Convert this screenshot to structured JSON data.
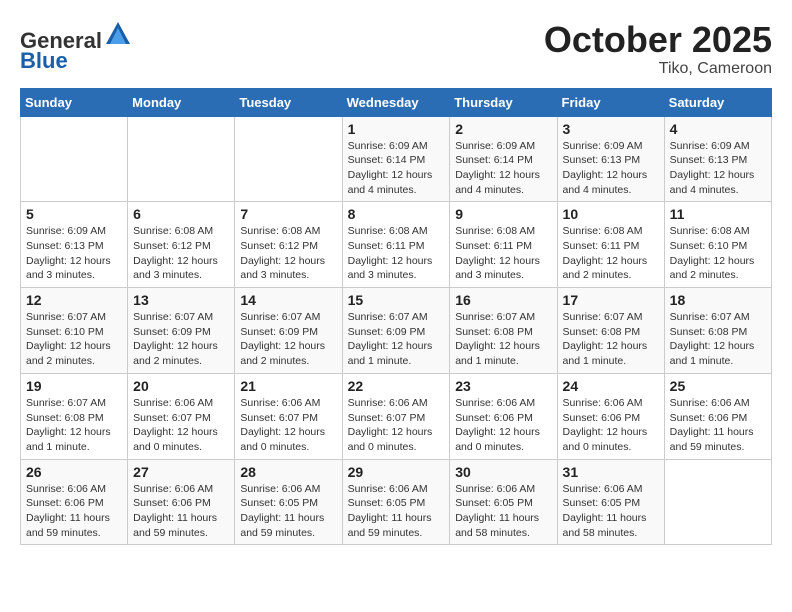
{
  "header": {
    "logo_line1": "General",
    "logo_line2": "Blue",
    "month": "October 2025",
    "location": "Tiko, Cameroon"
  },
  "weekdays": [
    "Sunday",
    "Monday",
    "Tuesday",
    "Wednesday",
    "Thursday",
    "Friday",
    "Saturday"
  ],
  "weeks": [
    [
      {
        "day": "",
        "info": ""
      },
      {
        "day": "",
        "info": ""
      },
      {
        "day": "",
        "info": ""
      },
      {
        "day": "1",
        "info": "Sunrise: 6:09 AM\nSunset: 6:14 PM\nDaylight: 12 hours and 4 minutes."
      },
      {
        "day": "2",
        "info": "Sunrise: 6:09 AM\nSunset: 6:14 PM\nDaylight: 12 hours and 4 minutes."
      },
      {
        "day": "3",
        "info": "Sunrise: 6:09 AM\nSunset: 6:13 PM\nDaylight: 12 hours and 4 minutes."
      },
      {
        "day": "4",
        "info": "Sunrise: 6:09 AM\nSunset: 6:13 PM\nDaylight: 12 hours and 4 minutes."
      }
    ],
    [
      {
        "day": "5",
        "info": "Sunrise: 6:09 AM\nSunset: 6:13 PM\nDaylight: 12 hours and 3 minutes."
      },
      {
        "day": "6",
        "info": "Sunrise: 6:08 AM\nSunset: 6:12 PM\nDaylight: 12 hours and 3 minutes."
      },
      {
        "day": "7",
        "info": "Sunrise: 6:08 AM\nSunset: 6:12 PM\nDaylight: 12 hours and 3 minutes."
      },
      {
        "day": "8",
        "info": "Sunrise: 6:08 AM\nSunset: 6:11 PM\nDaylight: 12 hours and 3 minutes."
      },
      {
        "day": "9",
        "info": "Sunrise: 6:08 AM\nSunset: 6:11 PM\nDaylight: 12 hours and 3 minutes."
      },
      {
        "day": "10",
        "info": "Sunrise: 6:08 AM\nSunset: 6:11 PM\nDaylight: 12 hours and 2 minutes."
      },
      {
        "day": "11",
        "info": "Sunrise: 6:08 AM\nSunset: 6:10 PM\nDaylight: 12 hours and 2 minutes."
      }
    ],
    [
      {
        "day": "12",
        "info": "Sunrise: 6:07 AM\nSunset: 6:10 PM\nDaylight: 12 hours and 2 minutes."
      },
      {
        "day": "13",
        "info": "Sunrise: 6:07 AM\nSunset: 6:09 PM\nDaylight: 12 hours and 2 minutes."
      },
      {
        "day": "14",
        "info": "Sunrise: 6:07 AM\nSunset: 6:09 PM\nDaylight: 12 hours and 2 minutes."
      },
      {
        "day": "15",
        "info": "Sunrise: 6:07 AM\nSunset: 6:09 PM\nDaylight: 12 hours and 1 minute."
      },
      {
        "day": "16",
        "info": "Sunrise: 6:07 AM\nSunset: 6:08 PM\nDaylight: 12 hours and 1 minute."
      },
      {
        "day": "17",
        "info": "Sunrise: 6:07 AM\nSunset: 6:08 PM\nDaylight: 12 hours and 1 minute."
      },
      {
        "day": "18",
        "info": "Sunrise: 6:07 AM\nSunset: 6:08 PM\nDaylight: 12 hours and 1 minute."
      }
    ],
    [
      {
        "day": "19",
        "info": "Sunrise: 6:07 AM\nSunset: 6:08 PM\nDaylight: 12 hours and 1 minute."
      },
      {
        "day": "20",
        "info": "Sunrise: 6:06 AM\nSunset: 6:07 PM\nDaylight: 12 hours and 0 minutes."
      },
      {
        "day": "21",
        "info": "Sunrise: 6:06 AM\nSunset: 6:07 PM\nDaylight: 12 hours and 0 minutes."
      },
      {
        "day": "22",
        "info": "Sunrise: 6:06 AM\nSunset: 6:07 PM\nDaylight: 12 hours and 0 minutes."
      },
      {
        "day": "23",
        "info": "Sunrise: 6:06 AM\nSunset: 6:06 PM\nDaylight: 12 hours and 0 minutes."
      },
      {
        "day": "24",
        "info": "Sunrise: 6:06 AM\nSunset: 6:06 PM\nDaylight: 12 hours and 0 minutes."
      },
      {
        "day": "25",
        "info": "Sunrise: 6:06 AM\nSunset: 6:06 PM\nDaylight: 11 hours and 59 minutes."
      }
    ],
    [
      {
        "day": "26",
        "info": "Sunrise: 6:06 AM\nSunset: 6:06 PM\nDaylight: 11 hours and 59 minutes."
      },
      {
        "day": "27",
        "info": "Sunrise: 6:06 AM\nSunset: 6:06 PM\nDaylight: 11 hours and 59 minutes."
      },
      {
        "day": "28",
        "info": "Sunrise: 6:06 AM\nSunset: 6:05 PM\nDaylight: 11 hours and 59 minutes."
      },
      {
        "day": "29",
        "info": "Sunrise: 6:06 AM\nSunset: 6:05 PM\nDaylight: 11 hours and 59 minutes."
      },
      {
        "day": "30",
        "info": "Sunrise: 6:06 AM\nSunset: 6:05 PM\nDaylight: 11 hours and 58 minutes."
      },
      {
        "day": "31",
        "info": "Sunrise: 6:06 AM\nSunset: 6:05 PM\nDaylight: 11 hours and 58 minutes."
      },
      {
        "day": "",
        "info": ""
      }
    ]
  ]
}
